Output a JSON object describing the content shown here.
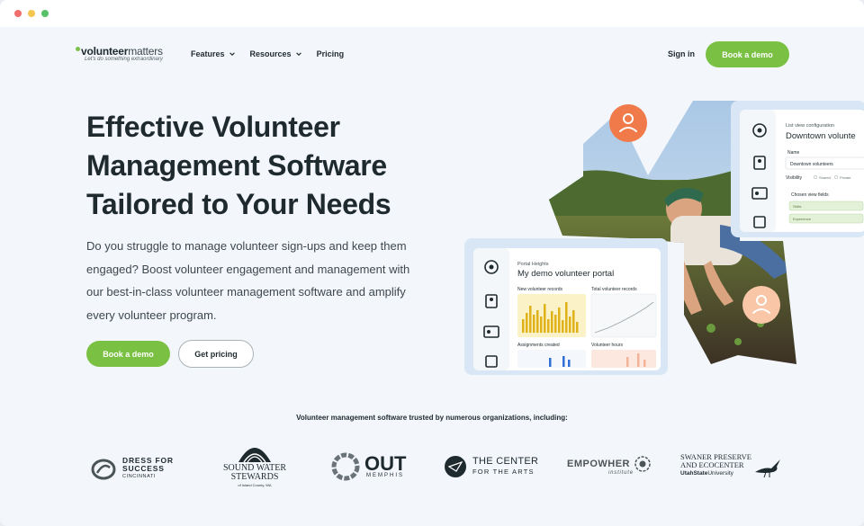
{
  "nav": {
    "logo_bold": "volunteer",
    "logo_light": "matters",
    "logo_tagline": "Let's do something extraordinary",
    "menu": [
      {
        "label": "Features",
        "has_dropdown": true
      },
      {
        "label": "Resources",
        "has_dropdown": true
      },
      {
        "label": "Pricing",
        "has_dropdown": false
      }
    ],
    "signin_label": "Sign in",
    "demo_label": "Book a demo"
  },
  "hero": {
    "title_lines": [
      "Effective Volunteer",
      "Management Software",
      "Tailored to Your Needs"
    ],
    "subtitle_lines": [
      "Do you struggle to manage volunteer sign-ups and keep them",
      "engaged? Boost volunteer engagement and management with",
      "our best-in-class volunteer management software and amplify",
      "every volunteer program."
    ],
    "demo_label": "Book a demo",
    "pricing_label": "Get pricing"
  },
  "portal_card": {
    "eyebrow": "Portal Heights",
    "title": "My demo volunteer portal",
    "widget_1": "New volunteer records",
    "widget_2": "Total volunteer records",
    "widget_3": "Assignments created",
    "widget_4": "Volunteer hours"
  },
  "config_card": {
    "eyebrow": "List view configuration",
    "title": "Downtown volunte",
    "name_label": "Name",
    "name_value": "Downtown volunteers",
    "visibility_label": "Visibility",
    "visibility_shared": "Shared",
    "visibility_private": "Private",
    "fields_label": "Chosen view fields",
    "field_1": "Skills",
    "field_2": "Experience"
  },
  "trusted_text": "Volunteer management software trusted by numerous organizations, including:",
  "orgs": {
    "dress": {
      "line1": "DRESS FOR",
      "line2": "SUCCESS",
      "line3": "CINCINNATI"
    },
    "sound": {
      "line1": "SOUND WATER",
      "line2": "STEWARDS",
      "line3": "of Island County, WA"
    },
    "out": {
      "line1": "OUT",
      "line2": "MEMPHIS"
    },
    "center": {
      "line1": "THE CENTER",
      "line2": "FOR THE ARTS"
    },
    "empower": {
      "line1": "EMPOWHER",
      "line2": "institute"
    },
    "swaner": {
      "line1": "SWANER PRESERVE",
      "line2": "AND ECOCENTER",
      "line3": "UtahState",
      "line4": "University"
    }
  },
  "colors": {
    "accent": "#7ac143",
    "avatar_orange": "#f07a4a",
    "avatar_peach": "#f9c6a8",
    "text_dark": "#1f2a2e"
  }
}
